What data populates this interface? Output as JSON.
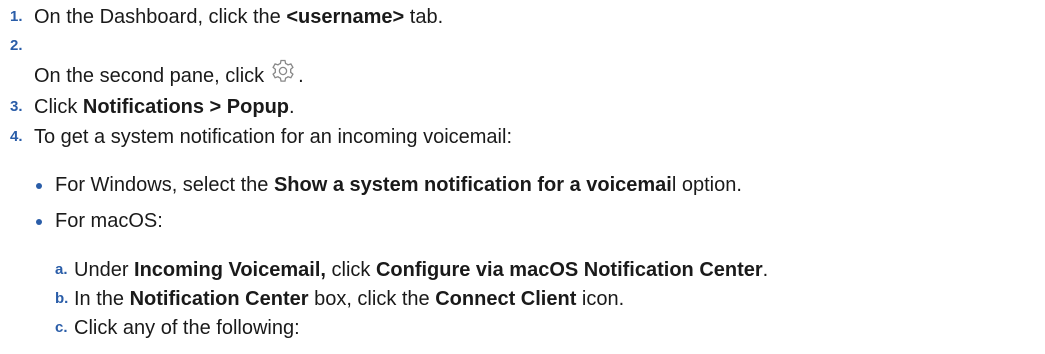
{
  "steps": [
    {
      "number": "1.",
      "parts": {
        "p1": "On the Dashboard, click the ",
        "b1": "<username>",
        "p2": " tab."
      }
    },
    {
      "number": "2.",
      "parts": {
        "p1": "On the second pane, click",
        "p2": "."
      },
      "icon": "gear-icon"
    },
    {
      "number": "3.",
      "parts": {
        "p1": "Click ",
        "b1": "Notifications > Popup",
        "p2": "."
      }
    },
    {
      "number": "4.",
      "parts": {
        "p1": "To get a system notification for an incoming voicemail:"
      }
    }
  ],
  "bullets": [
    {
      "p1": "For Windows, select the ",
      "b1": "Show a system notification for a voicemai",
      "p2": "l option."
    },
    {
      "p1": "For macOS:"
    }
  ],
  "substeps": [
    {
      "letter": "a.",
      "p1": "Under ",
      "b1": "Incoming Voicemail,",
      "p2": " click ",
      "b2": "Configure via macOS Notification Center",
      "p3": "."
    },
    {
      "letter": "b.",
      "p1": "In the ",
      "b1": "Notification Center",
      "p2": " box, click the ",
      "b2": "Connect Client",
      "p3": " icon."
    },
    {
      "letter": "c.",
      "p1": "Click any of the following:"
    }
  ],
  "colors": {
    "accent": "#2a5da8",
    "text": "#1a1a1a",
    "icon": "#888888"
  }
}
